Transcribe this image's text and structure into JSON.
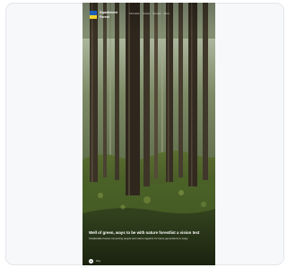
{
  "colors": {
    "page_background": "#ffffff",
    "card_background": "#f7f8fa",
    "card_border": "#e3e6ea",
    "flag_blue": "#1a5fb4",
    "flag_yellow": "#f6d32d",
    "text_on_image": "#ffffff"
  },
  "header": {
    "logo_icon": "flag-icon",
    "logo_line1": "Dipartiment",
    "logo_line2": "Forest",
    "nav": [
      "Information",
      "Content",
      "Services",
      "About"
    ]
  },
  "hero": {
    "title": "Well of green, ways to be with nature forestlist a vision text",
    "subtitle": "Sustainable forests connecting people and nature together for future generations to enjoy.",
    "play_icon": "play-icon",
    "play_label": "Play"
  }
}
